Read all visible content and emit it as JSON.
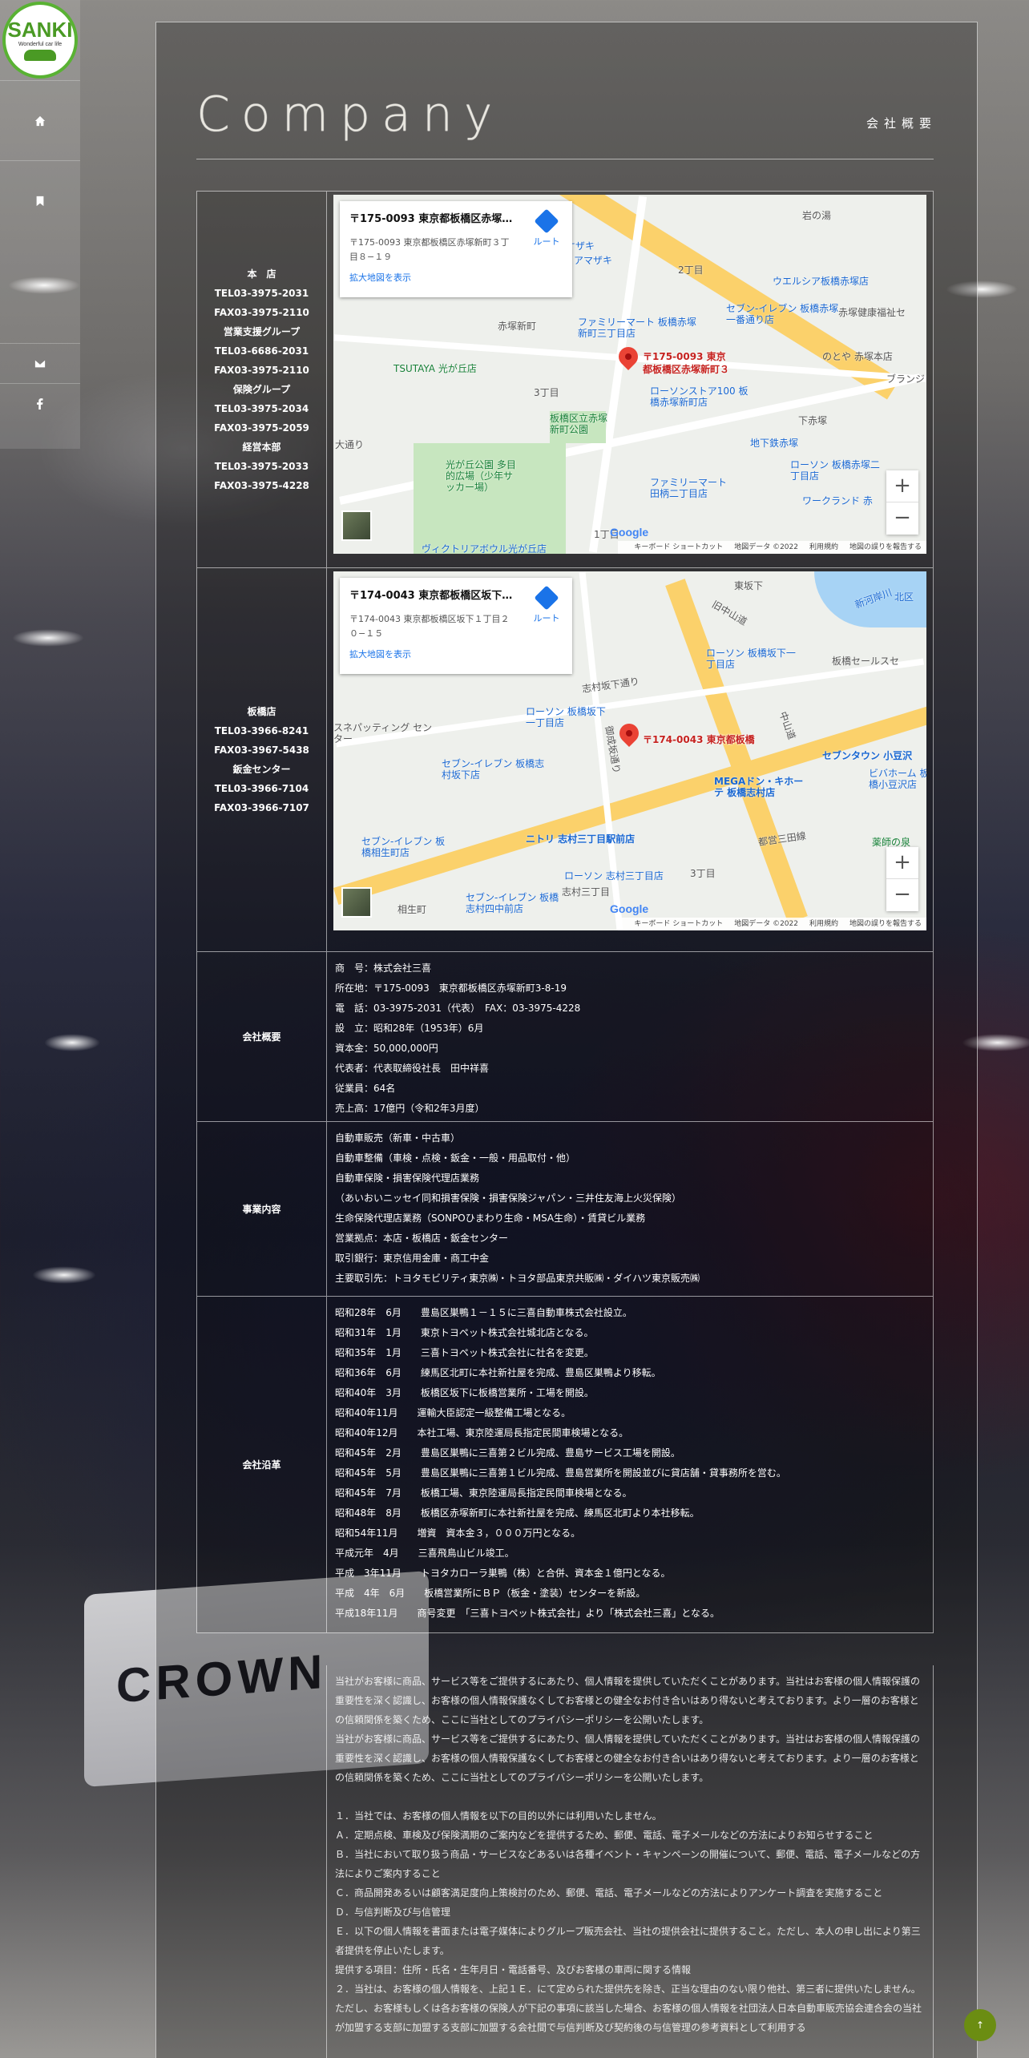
{
  "brand": {
    "logo_main": "SANKI",
    "logo_sub": "Wonderful car life"
  },
  "page": {
    "title": "Company",
    "subtitle": "会社概要"
  },
  "sections": {
    "office1_lines": [
      "本　店",
      "TEL03-3975-2031",
      "FAX03-3975-2110",
      "営業支援グループ",
      "TEL03-6686-2031",
      "FAX03-3975-2110",
      "保険グループ",
      "TEL03-3975-2034",
      "FAX03-3975-2059",
      "経営本部",
      "TEL03-3975-2033",
      "FAX03-3975-4228"
    ],
    "office2_lines": [
      "板橋店",
      "TEL03-3966-8241",
      "FAX03-3967-5438",
      "鈑金センター",
      "TEL03-3966-7104",
      "FAX03-3966-7107"
    ],
    "overview_label": "会社概要",
    "overview_lines": [
      "商　号：株式会社三喜",
      "所在地：〒175-0093　東京都板橋区赤塚新町3-8-19",
      "電　話：03-3975-2031（代表）　FAX：03-3975-4228",
      "設　立：昭和28年（1953年）6月",
      "資本金：50,000,000円",
      "代表者：代表取締役社長　田中祥喜",
      "従業員：64名",
      "売上高：17億円（令和2年3月度）"
    ],
    "business_label": "事業内容",
    "business_lines": [
      "自動車販売（新車・中古車）",
      "自動車整備（車検・点検・鈑金・一般・用品取付・他）",
      "自動車保険・損害保険代理店業務",
      "（あいおいニッセイ同和損害保険・損害保険ジャパン・三井住友海上火災保険）",
      "生命保険代理店業務（SONPOひまわり生命・MSA生命）・賃貸ビル業務",
      "営業拠点：本店・板橋店・鈑金センター",
      "取引銀行：東京信用金庫・商工中金",
      "主要取引先：トヨタモビリティ東京㈱・トヨタ部品東京共販㈱・ダイハツ東京販売㈱"
    ],
    "history_label": "会社沿革",
    "history_lines": [
      "昭和28年　6月　　豊島区巣鴨１－１５に三喜自動車株式会社設立。",
      "昭和31年　1月　　東京トヨペット株式会社城北店となる。",
      "昭和35年　1月　　三喜トヨペット株式会社に社名を変更。",
      "昭和36年　6月　　練馬区北町に本社新社屋を完成、豊島区巣鴨より移転。",
      "昭和40年　3月　　板橋区坂下に板橋営業所・工場を開設。",
      "昭和40年11月　　運輸大臣認定一級整備工場となる。",
      "昭和40年12月　　本社工場、東京陸運局長指定民間車検場となる。",
      "昭和45年　2月　　豊島区巣鴨に三喜第２ビル完成、豊島サービス工場を開設。",
      "昭和45年　5月　　豊島区巣鴨に三喜第１ビル完成、豊島営業所を開設並びに貸店舗・貸事務所を営む。",
      "昭和45年　7月　　板橋工場、東京陸運局長指定民間車検場となる。",
      "昭和48年　8月　　板橋区赤塚新町に本社新社屋を完成、練馬区北町より本社移転。",
      "昭和54年11月　　増資　資本金３，０００万円となる。",
      "平成元年　4月　　三喜飛鳥山ビル竣工。",
      "平成　3年11月　　トヨタカローラ巣鴨（株）と合併、資本金１億円となる。",
      "平成　4年　6月　　板橋営業所にＢＰ（板金・塗装）センターを新設。",
      "平成18年11月　　商号変更　「三喜トヨペット株式会社」より「株式会社三喜」となる。"
    ],
    "privacy_paragraphs": [
      "当社がお客様に商品、サービス等をご提供するにあたり、個人情報を提供していただくことがあります。当社はお客様の個人情報保護の重要性を深く認識し、お客様の個人情報保護なくしてお客様との健全なお付き合いはあり得ないと考えております。より一層のお客様との信頼関係を築くため、ここに当社としてのプライバシーポリシーを公開いたします。",
      "当社がお客様に商品、サービス等をご提供するにあたり、個人情報を提供していただくことがあります。当社はお客様の個人情報保護の重要性を深く認識し、お客様の個人情報保護なくしてお客様との健全なお付き合いはあり得ないと考えております。より一層のお客様との信頼関係を築くため、ここに当社としてのプライバシーポリシーを公開いたします。",
      "",
      "１．当社では、お客様の個人情報を以下の目的以外には利用いたしません。",
      "Ａ．定期点検、車検及び保険満期のご案内などを提供するため、郵便、電話、電子メールなどの方法によりお知らせすること",
      "Ｂ．当社において取り扱う商品・サービスなどあるいは各種イベント・キャンペーンの開催について、郵便、電話、電子メールなどの方法によりご案内すること",
      "Ｃ．商品開発あるいは顧客満足度向上策検討のため、郵便、電話、電子メールなどの方法によりアンケート調査を実施すること",
      "Ｄ．与信判断及び与信管理",
      "Ｅ．以下の個人情報を書面または電子媒体によりグループ販売会社、当社の提供会社に提供すること。ただし、本人の申し出により第三者提供を停止いたします。",
      "提供する項目：住所・氏名・生年月日・電話番号、及びお客様の車両に関する情報",
      "２．当社は、お客様の個人情報を、上記１Ｅ．にて定められた提供先を除き、正当な理由のない限り他社、第三者に提供いたしません。ただし、お客様もしくは各お客様の保険人が下記の事項に該当した場合、お客様の個人情報を社団法人日本自動車販売協会連合会の当社が加盟する支部に加盟する支部に加盟する会社間で与信判断及び契約後の与信管理の参考資料として利用する"
    ]
  },
  "map1": {
    "place_name": "〒175-0093 東京都板橋区赤塚…",
    "address": "〒175-0093 東京都板橋区赤塚新町３丁目８−１９",
    "link": "拡大地図を表示",
    "route": "ルート",
    "pin_label_1": "〒175-0093 東京",
    "pin_label_2": "都板橋区赤塚新町３",
    "labels": [
      "岩の湯",
      "2丁目",
      "ウエルシア板橋赤塚店",
      "赤塚新町",
      "ファミリーマート 板橋赤塚新町三丁目店",
      "セブン-イレブン 板橋赤塚一番通り店",
      "赤塚健康福祉セ",
      "のとや 赤塚本店",
      "ブランジ",
      "TSUTAYA 光が丘店",
      "3丁目",
      "ローソンストア100 板橋赤塚新町店",
      "下赤塚",
      "板橋区立赤塚新町公園",
      "地下鉄赤塚",
      "光が丘公園 多目的広場（少年サッカー場）",
      "ローソン 板橋赤塚二丁目店",
      "ファミリーマート 田柄二丁目店",
      "ワークランド 赤",
      "1丁目",
      "ヴィクトリアボウル光が丘店",
      "大通り",
      "オザキ",
      "アマザキ"
    ],
    "brand": "Google",
    "attr": [
      "キーボード ショートカット",
      "地図データ ©2022",
      "利用規約",
      "地図の誤りを報告する"
    ]
  },
  "map2": {
    "place_name": "〒174-0043 東京都板橋区坂下…",
    "address": "〒174-0043 東京都板橋区坂下１丁目２０−１５",
    "link": "拡大地図を表示",
    "route": "ルート",
    "pin_label": "〒174-0043 東京都板橋",
    "labels": [
      "東坂下",
      "新河岸川",
      "旧中山道",
      "北区",
      "ローソン 板橋坂下一丁目店",
      "板橋セールスセ",
      "志村坂下通り",
      "ローソン 板橋坂下一丁目店",
      "セブン-イレブン 板橋志村坂下店",
      "ニトリ 志村三丁目駅前店",
      "MEGAドン・キホーテ 板橋志村店",
      "セブンタウン 小豆沢",
      "ビバホーム 板橋小豆沢店",
      "薬師の泉",
      "セブン-イレブン 板橋相生町店",
      "ローソン 志村三丁目店",
      "志村三丁目",
      "相生町",
      "セブン-イレブン 板橋志村四中前店",
      "3丁目",
      "中山道",
      "御成坂通り",
      "都営三田線",
      "スネパッティング センター",
      "志村三丁目"
    ],
    "brand": "Google",
    "attr": [
      "キーボード ショートカット",
      "地図データ ©2022",
      "利用規約",
      "地図の誤りを報告する"
    ]
  },
  "icons": {
    "home": "home-icon",
    "bookmark": "bookmark-icon",
    "mail": "mail-icon",
    "facebook": "facebook-icon",
    "top": "back-to-top-icon"
  },
  "colors": {
    "logo_green": "#4a9a24",
    "map_link": "#1a73e8",
    "pin": "#ea4335",
    "top_button": "#6b8d12"
  }
}
